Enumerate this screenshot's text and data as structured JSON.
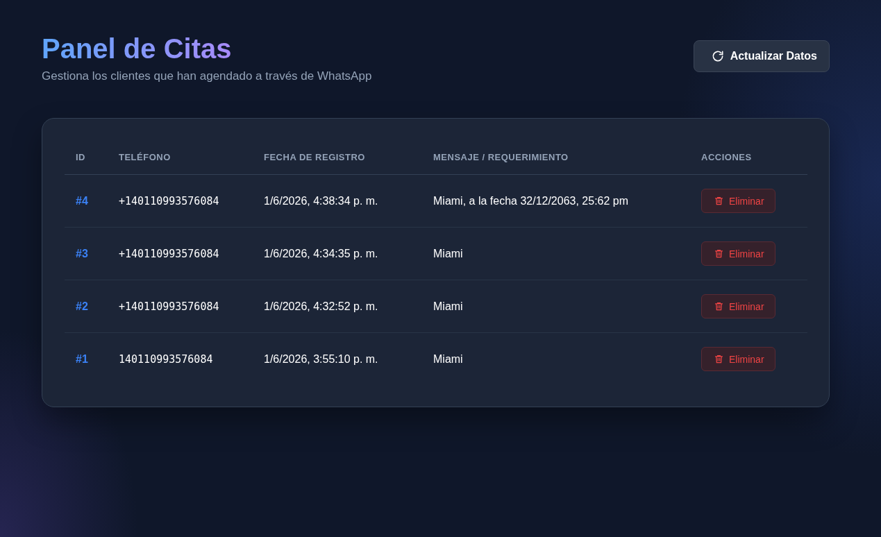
{
  "header": {
    "title": "Panel de Citas",
    "subtitle": "Gestiona los clientes que han agendado a través de WhatsApp",
    "refresh_button": "Actualizar Datos"
  },
  "table": {
    "columns": [
      "ID",
      "TELÉFONO",
      "FECHA DE REGISTRO",
      "MENSAJE / REQUERIMIENTO",
      "ACCIONES"
    ],
    "rows": [
      {
        "id": "#4",
        "phone": "+140110993576084",
        "date": "1/6/2026, 4:38:34 p. m.",
        "message": "Miami, a la fecha 32/12/2063, 25:62 pm",
        "action": "Eliminar"
      },
      {
        "id": "#3",
        "phone": "+140110993576084",
        "date": "1/6/2026, 4:34:35 p. m.",
        "message": "Miami",
        "action": "Eliminar"
      },
      {
        "id": "#2",
        "phone": "+140110993576084",
        "date": "1/6/2026, 4:32:52 p. m.",
        "message": "Miami",
        "action": "Eliminar"
      },
      {
        "id": "#1",
        "phone": "140110993576084",
        "date": "1/6/2026, 3:55:10 p. m.",
        "message": "Miami",
        "action": "Eliminar"
      }
    ]
  }
}
